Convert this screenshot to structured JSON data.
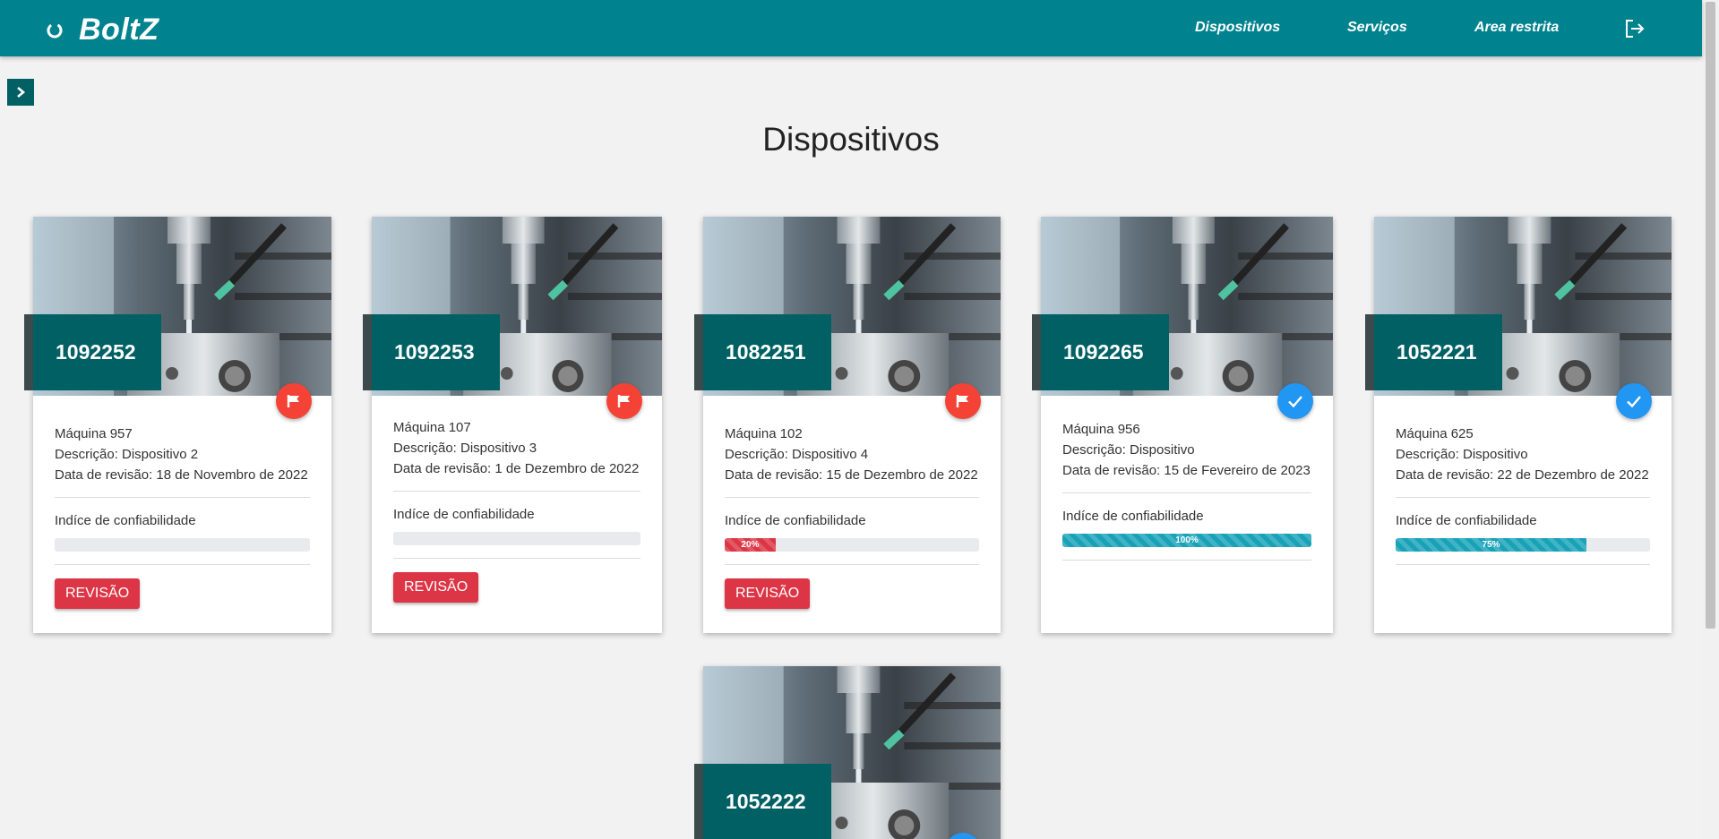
{
  "header": {
    "brand": "BoltZ",
    "nav": [
      "Dispositivos",
      "Serviços",
      "Area restrita"
    ]
  },
  "page": {
    "title": "Dispositivos"
  },
  "labels": {
    "reliability": "Indíce de confiabilidade",
    "review_button": "REVISÃO"
  },
  "colors": {
    "primary": "#00838f",
    "badge": "#006064",
    "danger": "#dc3545",
    "flag": "#f44336",
    "ok": "#2196f3",
    "progress_info": "#17a2b8"
  },
  "cards": [
    {
      "id": "1092252",
      "status": "flag-icon",
      "machine": "Máquina 957",
      "description": "Descrição: Dispositivo 2",
      "review_date": "Data de revisão: 18 de Novembro de 2022",
      "reliability": 0,
      "reliability_label": "",
      "show_button": true
    },
    {
      "id": "1092253",
      "status": "flag-icon",
      "machine": "Máquina 107",
      "description": "Descrição: Dispositivo 3",
      "review_date": "Data de revisão: 1 de Dezembro de 2022",
      "reliability": 0,
      "reliability_label": "",
      "show_button": true
    },
    {
      "id": "1082251",
      "status": "flag-icon",
      "machine": "Máquina 102",
      "description": "Descrição: Dispositivo 4",
      "review_date": "Data de revisão: 15 de Dezembro de 2022",
      "reliability": 20,
      "reliability_label": "20%",
      "show_button": true
    },
    {
      "id": "1092265",
      "status": "check-icon",
      "machine": "Máquina 956",
      "description": "Descrição: Dispositivo",
      "review_date": "Data de revisão: 15 de Fevereiro de 2023",
      "reliability": 100,
      "reliability_label": "100%",
      "show_button": false
    },
    {
      "id": "1052221",
      "status": "check-icon",
      "machine": "Máquina 625",
      "description": "Descrição: Dispositivo",
      "review_date": "Data de revisão: 22 de Dezembro de 2022",
      "reliability": 75,
      "reliability_label": "75%",
      "show_button": false
    },
    {
      "id": "1052222",
      "status": "check-icon"
    }
  ]
}
